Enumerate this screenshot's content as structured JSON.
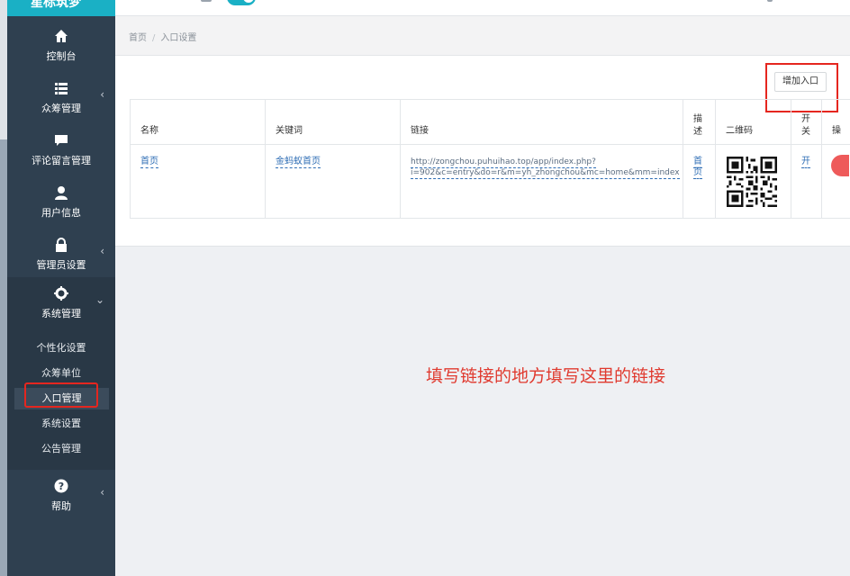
{
  "brand": {
    "title": "星标筑梦"
  },
  "sidebar": {
    "items": [
      {
        "label": "控制台",
        "icon": "home-icon"
      },
      {
        "label": "众筹管理",
        "icon": "list-icon",
        "chevron": "‹"
      },
      {
        "label": "评论留言管理",
        "icon": "comment-icon"
      },
      {
        "label": "用户信息",
        "icon": "user-icon"
      },
      {
        "label": "管理员设置",
        "icon": "lock-icon",
        "chevron": "‹"
      },
      {
        "label": "系统管理",
        "icon": "gear-icon",
        "chevron": "⌄"
      },
      {
        "label": "帮助",
        "icon": "question-icon",
        "chevron": "‹"
      }
    ],
    "submenu": [
      "个性化设置",
      "众筹单位",
      "入口管理",
      "系统设置",
      "公告管理"
    ]
  },
  "breadcrumb": {
    "home": "首页",
    "sep": "/",
    "current": "入口设置"
  },
  "toolbar": {
    "add_label": "增加入口"
  },
  "table": {
    "headers": [
      "名称",
      "关键词",
      "链接",
      "描述",
      "二维码",
      "开关",
      "操"
    ],
    "header_lines": {
      "desc": [
        "描",
        "述"
      ],
      "switch": [
        "开",
        "关"
      ]
    },
    "row": {
      "name": "首页",
      "keyword": "金蚂蚁首页",
      "link_line1": "http://zongchou.puhuihao.top/app/index.php?",
      "link_line2": "i=902&c=entry&do=r&m=yh_zhongchou&mc=home&mm=index",
      "desc_line1": "首",
      "desc_line2": "页",
      "switch": "开"
    }
  },
  "annotation": {
    "text": "填写链接的地方填写这里的链接",
    "color": "#e03a2f"
  },
  "colors": {
    "sidebar": "#2f4050",
    "accent": "#1ab0c5",
    "highlight": "#e5261f",
    "link": "#2f6eb5"
  }
}
